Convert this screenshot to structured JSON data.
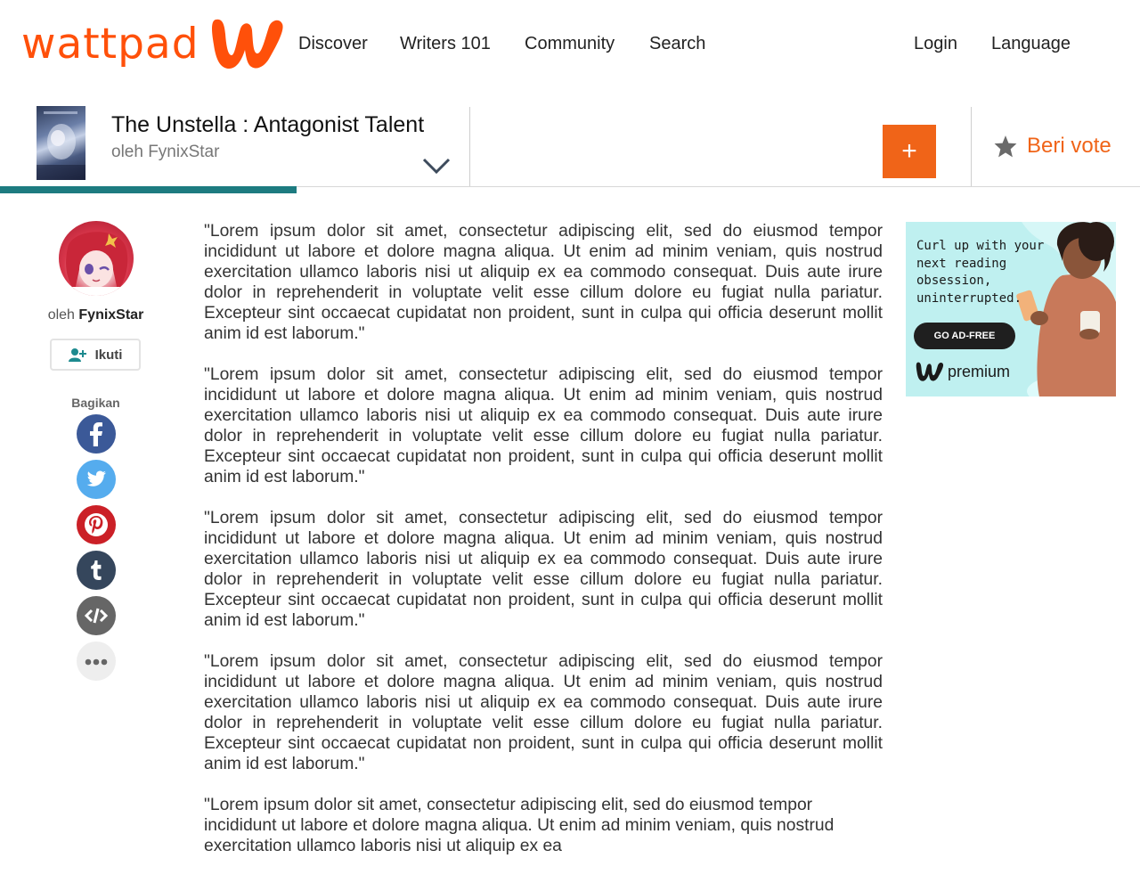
{
  "nav": {
    "logo_text": "wattpad",
    "links": [
      "Discover",
      "Writers 101",
      "Community",
      "Search"
    ],
    "login": "Login",
    "language": "Language"
  },
  "story": {
    "title": "The Unstella : Antagonist Talent",
    "author_line": "oleh FynixStar",
    "add_label": "+",
    "vote_label": "Beri vote",
    "reading_progress": 0.26
  },
  "author": {
    "by_prefix": "oleh",
    "name": "FynixStar",
    "follow_label": "Ikuti"
  },
  "share": {
    "label": "Bagikan",
    "buttons": [
      {
        "icon": "facebook-icon",
        "color": "#3b5998"
      },
      {
        "icon": "twitter-icon",
        "color": "#55acee"
      },
      {
        "icon": "pinterest-icon",
        "color": "#cb2027"
      },
      {
        "icon": "tumblr-icon",
        "color": "#35465c"
      },
      {
        "icon": "embed-icon",
        "color": "#666666"
      },
      {
        "icon": "more-icon",
        "color": "#eeeeee"
      }
    ]
  },
  "content": {
    "paragraphs": [
      "\"Lorem ipsum dolor sit amet, consectetur adipiscing elit, sed do eiusmod tempor incididunt ut labore et dolore magna aliqua. Ut enim ad minim veniam, quis nostrud exercitation ullamco laboris nisi ut aliquip ex ea commodo consequat. Duis aute irure dolor in reprehenderit in voluptate velit esse cillum dolore eu fugiat nulla pariatur. Excepteur sint occaecat cupidatat non proident, sunt in culpa qui officia deserunt mollit anim id est laborum.\"",
      "\"Lorem ipsum dolor sit amet, consectetur adipiscing elit, sed do eiusmod tempor incididunt ut labore et dolore magna aliqua. Ut enim ad minim veniam, quis nostrud exercitation ullamco laboris nisi ut aliquip ex ea commodo consequat. Duis aute irure dolor in reprehenderit in voluptate velit esse cillum dolore eu fugiat nulla pariatur. Excepteur sint occaecat cupidatat non proident, sunt in culpa qui officia deserunt mollit anim id est laborum.\"",
      "\"Lorem ipsum dolor sit amet, consectetur adipiscing elit, sed do eiusmod tempor incididunt ut labore et dolore magna aliqua. Ut enim ad minim veniam, quis nostrud exercitation ullamco laboris nisi ut aliquip ex ea commodo consequat. Duis aute irure dolor in reprehenderit in voluptate velit esse cillum dolore eu fugiat nulla pariatur. Excepteur sint occaecat cupidatat non proident, sunt in culpa qui officia deserunt mollit anim id est laborum.\"",
      "\"Lorem ipsum dolor sit amet, consectetur adipiscing elit, sed do eiusmod tempor incididunt ut labore et dolore magna aliqua. Ut enim ad minim veniam, quis nostrud exercitation ullamco laboris nisi ut aliquip ex ea commodo consequat. Duis aute irure dolor in reprehenderit in voluptate velit esse cillum dolore eu fugiat nulla pariatur. Excepteur sint occaecat cupidatat non proident, sunt in culpa qui officia deserunt mollit anim id est laborum.\"",
      "\"Lorem ipsum dolor sit amet, consectetur adipiscing elit, sed do eiusmod tempor incididunt ut labore et dolore magna aliqua. Ut enim ad minim veniam, quis nostrud exercitation ullamco laboris nisi ut aliquip ex ea"
    ]
  },
  "ad": {
    "text": "Curl up with your next reading obsession, uninterrupted.",
    "button": "GO AD-FREE",
    "brand": "premium"
  },
  "colors": {
    "brand": "#ff500a",
    "accent": "#f06418",
    "progress": "#1d7b80",
    "ad_bg": "#bff0f0"
  }
}
